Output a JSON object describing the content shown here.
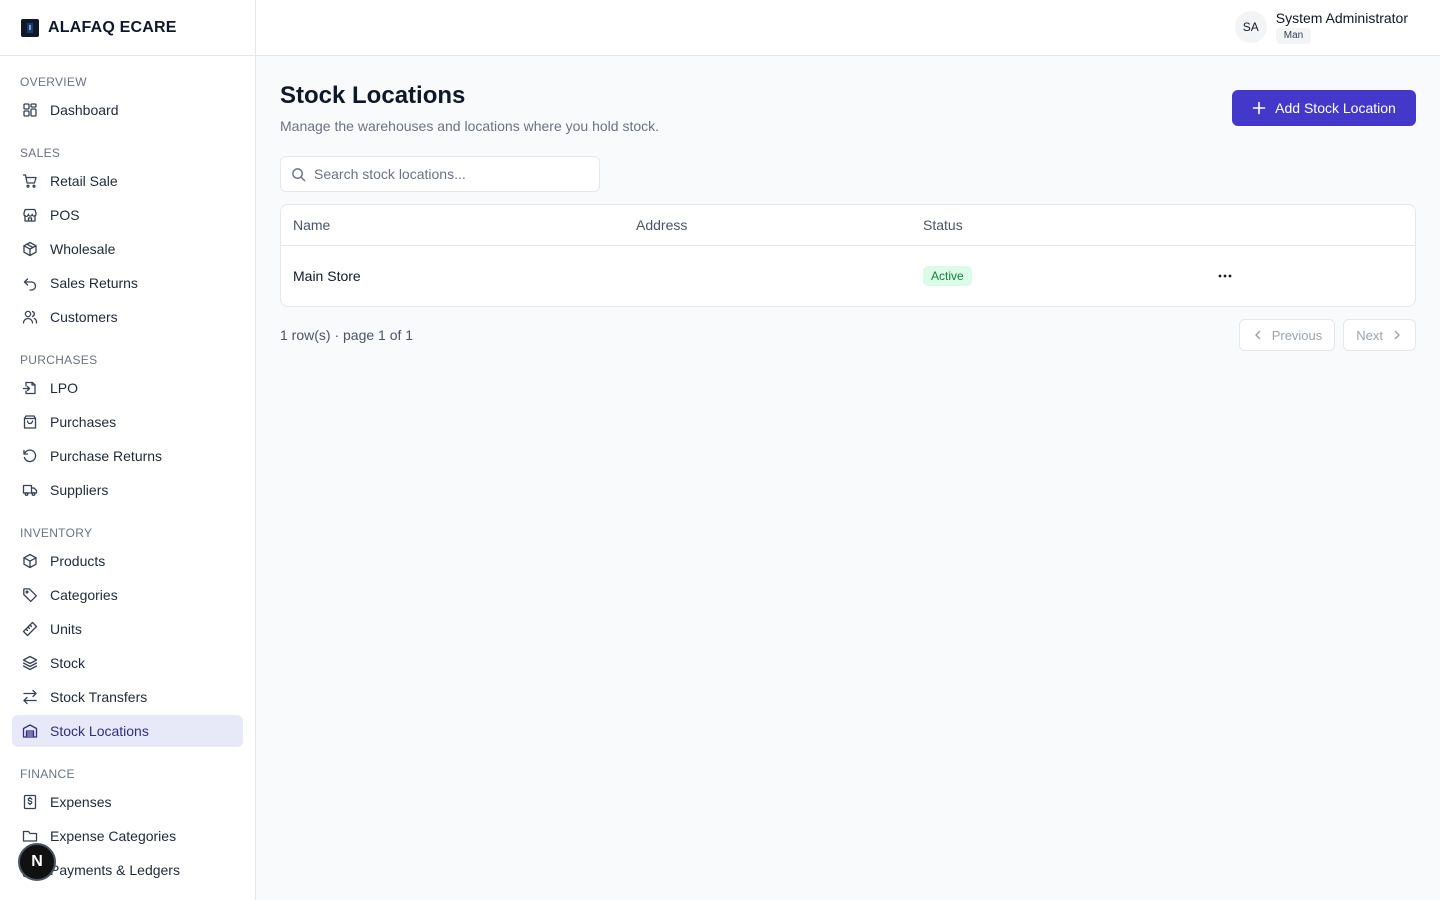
{
  "brand": {
    "name": "ALAFAQ ECARE"
  },
  "user": {
    "initials": "SA",
    "name": "System Administrator",
    "role": "Man"
  },
  "sidebar": {
    "sections": [
      {
        "label": "OVERVIEW",
        "items": [
          {
            "label": "Dashboard",
            "icon": "dashboard-icon"
          }
        ]
      },
      {
        "label": "SALES",
        "items": [
          {
            "label": "Retail Sale",
            "icon": "cart-icon"
          },
          {
            "label": "POS",
            "icon": "store-icon"
          },
          {
            "label": "Wholesale",
            "icon": "package-icon"
          },
          {
            "label": "Sales Returns",
            "icon": "undo-icon"
          },
          {
            "label": "Customers",
            "icon": "users-icon"
          }
        ]
      },
      {
        "label": "PURCHASES",
        "items": [
          {
            "label": "LPO",
            "icon": "file-import-icon"
          },
          {
            "label": "Purchases",
            "icon": "bag-icon"
          },
          {
            "label": "Purchase Returns",
            "icon": "rotate-ccw-icon"
          },
          {
            "label": "Suppliers",
            "icon": "truck-icon"
          }
        ]
      },
      {
        "label": "INVENTORY",
        "items": [
          {
            "label": "Products",
            "icon": "box-icon"
          },
          {
            "label": "Categories",
            "icon": "tag-icon"
          },
          {
            "label": "Units",
            "icon": "ruler-icon"
          },
          {
            "label": "Stock",
            "icon": "layers-icon"
          },
          {
            "label": "Stock Transfers",
            "icon": "arrows-transfer-icon"
          },
          {
            "label": "Stock Locations",
            "icon": "warehouse-icon",
            "active": true
          }
        ]
      },
      {
        "label": "FINANCE",
        "items": [
          {
            "label": "Expenses",
            "icon": "receipt-dollar-icon"
          },
          {
            "label": "Expense Categories",
            "icon": "folder-icon"
          },
          {
            "label": "Payments & Ledgers",
            "icon": "wallet-icon"
          }
        ]
      }
    ]
  },
  "page": {
    "title": "Stock Locations",
    "subtitle": "Manage the warehouses and locations where you hold stock.",
    "add_button_label": "Add Stock Location"
  },
  "search": {
    "placeholder": "Search stock locations...",
    "value": ""
  },
  "table": {
    "columns": [
      "Name",
      "Address",
      "Status"
    ],
    "rows": [
      {
        "name": "Main Store",
        "address": "",
        "status": "Active"
      }
    ]
  },
  "footer": {
    "row_count": "1 row(s) · page 1 of 1",
    "previous_label": "Previous",
    "next_label": "Next"
  },
  "floating_badge": {
    "letter": "N"
  },
  "colors": {
    "accent": "#4338ca",
    "active_bg": "#e8e9f8",
    "status_active_bg": "#dcfce7",
    "status_active_fg": "#15803d"
  }
}
